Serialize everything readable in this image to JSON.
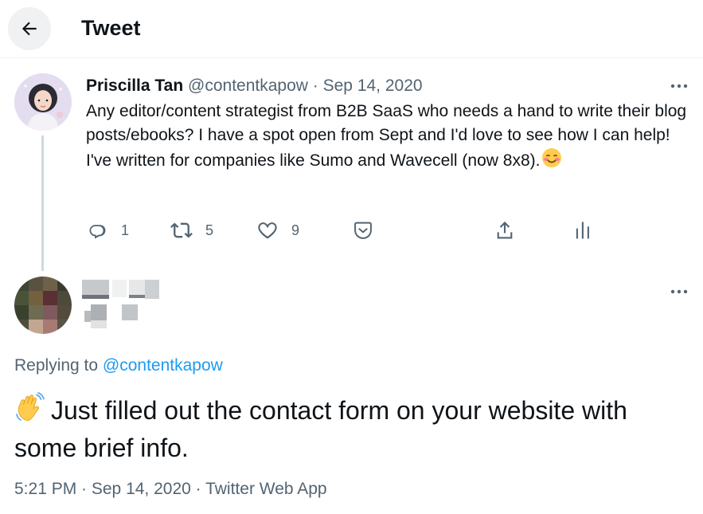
{
  "header": {
    "title": "Tweet",
    "back_icon": "arrow-left-icon"
  },
  "original_tweet": {
    "name": "Priscilla Tan",
    "handle": "@contentkapow",
    "separator": "·",
    "date": "Sep 14, 2020",
    "text": "Any editor/content strategist from B2B SaaS who needs a hand to write their blog posts/ebooks? I have a spot open from Sept and I'd love to see how I can help! I've written for companies like Sumo and Wavecell (now 8x8).",
    "emoji": "smiling-face-with-smiling-eyes",
    "actions": {
      "reply_count": "1",
      "retweet_count": "5",
      "like_count": "9"
    }
  },
  "reply_tweet": {
    "replying_prefix": "Replying to ",
    "replying_handle": "@contentkapow",
    "emoji": "waving-hand",
    "text": "Just filled out the contact form on your website with some brief info.",
    "meta": "5:21 PM · Sep 14, 2020 · Twitter Web App"
  },
  "colors": {
    "text": "#0f1419",
    "muted": "#536471",
    "link": "#1d9bf0",
    "thread_line": "#cfd9de"
  }
}
